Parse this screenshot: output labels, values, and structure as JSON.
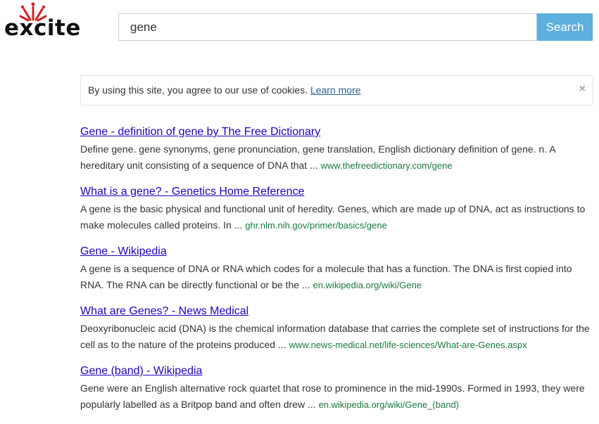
{
  "logo": {
    "text": "excite",
    "colors": {
      "wordmark": "#111111",
      "splash": "#d62020"
    }
  },
  "search": {
    "value": "gene",
    "button_label": "Search"
  },
  "cookie_notice": {
    "text": "By using this site, you agree to our use of cookies.",
    "link_label": "Learn more",
    "close_label": "×"
  },
  "results": [
    {
      "title": "Gene - definition of gene by The Free Dictionary",
      "snippet": "Define gene. gene synonyms, gene pronunciation, gene translation, English dictionary definition of gene. n. A hereditary unit consisting of a sequence of DNA that ...",
      "url": "www.thefreedictionary.com/gene"
    },
    {
      "title": "What is a gene? - Genetics Home Reference",
      "snippet": "A gene is the basic physical and functional unit of heredity. Genes, which are made up of DNA, act as instructions to make molecules called proteins. In ...",
      "url": "ghr.nlm.nih.gov/primer/basics/gene"
    },
    {
      "title": "Gene - Wikipedia",
      "snippet": "A gene is a sequence of DNA or RNA which codes for a molecule that has a function. The DNA is first copied into RNA. The RNA can be directly functional or be the ...",
      "url": "en.wikipedia.org/wiki/Gene"
    },
    {
      "title": "What are Genes? - News Medical",
      "snippet": "Deoxyribonucleic acid (DNA) is the chemical information database that carries the complete set of instructions for the cell as to the nature of the proteins produced ...",
      "url": "www.news-medical.net/life-sciences/What-are-Genes.aspx"
    },
    {
      "title": "Gene (band) - Wikipedia",
      "snippet": "Gene were an English alternative rock quartet that rose to prominence in the mid-1990s. Formed in 1993, they were popularly labelled as a Britpop band and often drew ...",
      "url": "en.wikipedia.org/wiki/Gene_(band)"
    }
  ],
  "colors": {
    "search_button": "#5bb0de",
    "result_title": "#2200c1",
    "result_url": "#1b7a3e",
    "cookie_link": "#2a5d8f"
  }
}
